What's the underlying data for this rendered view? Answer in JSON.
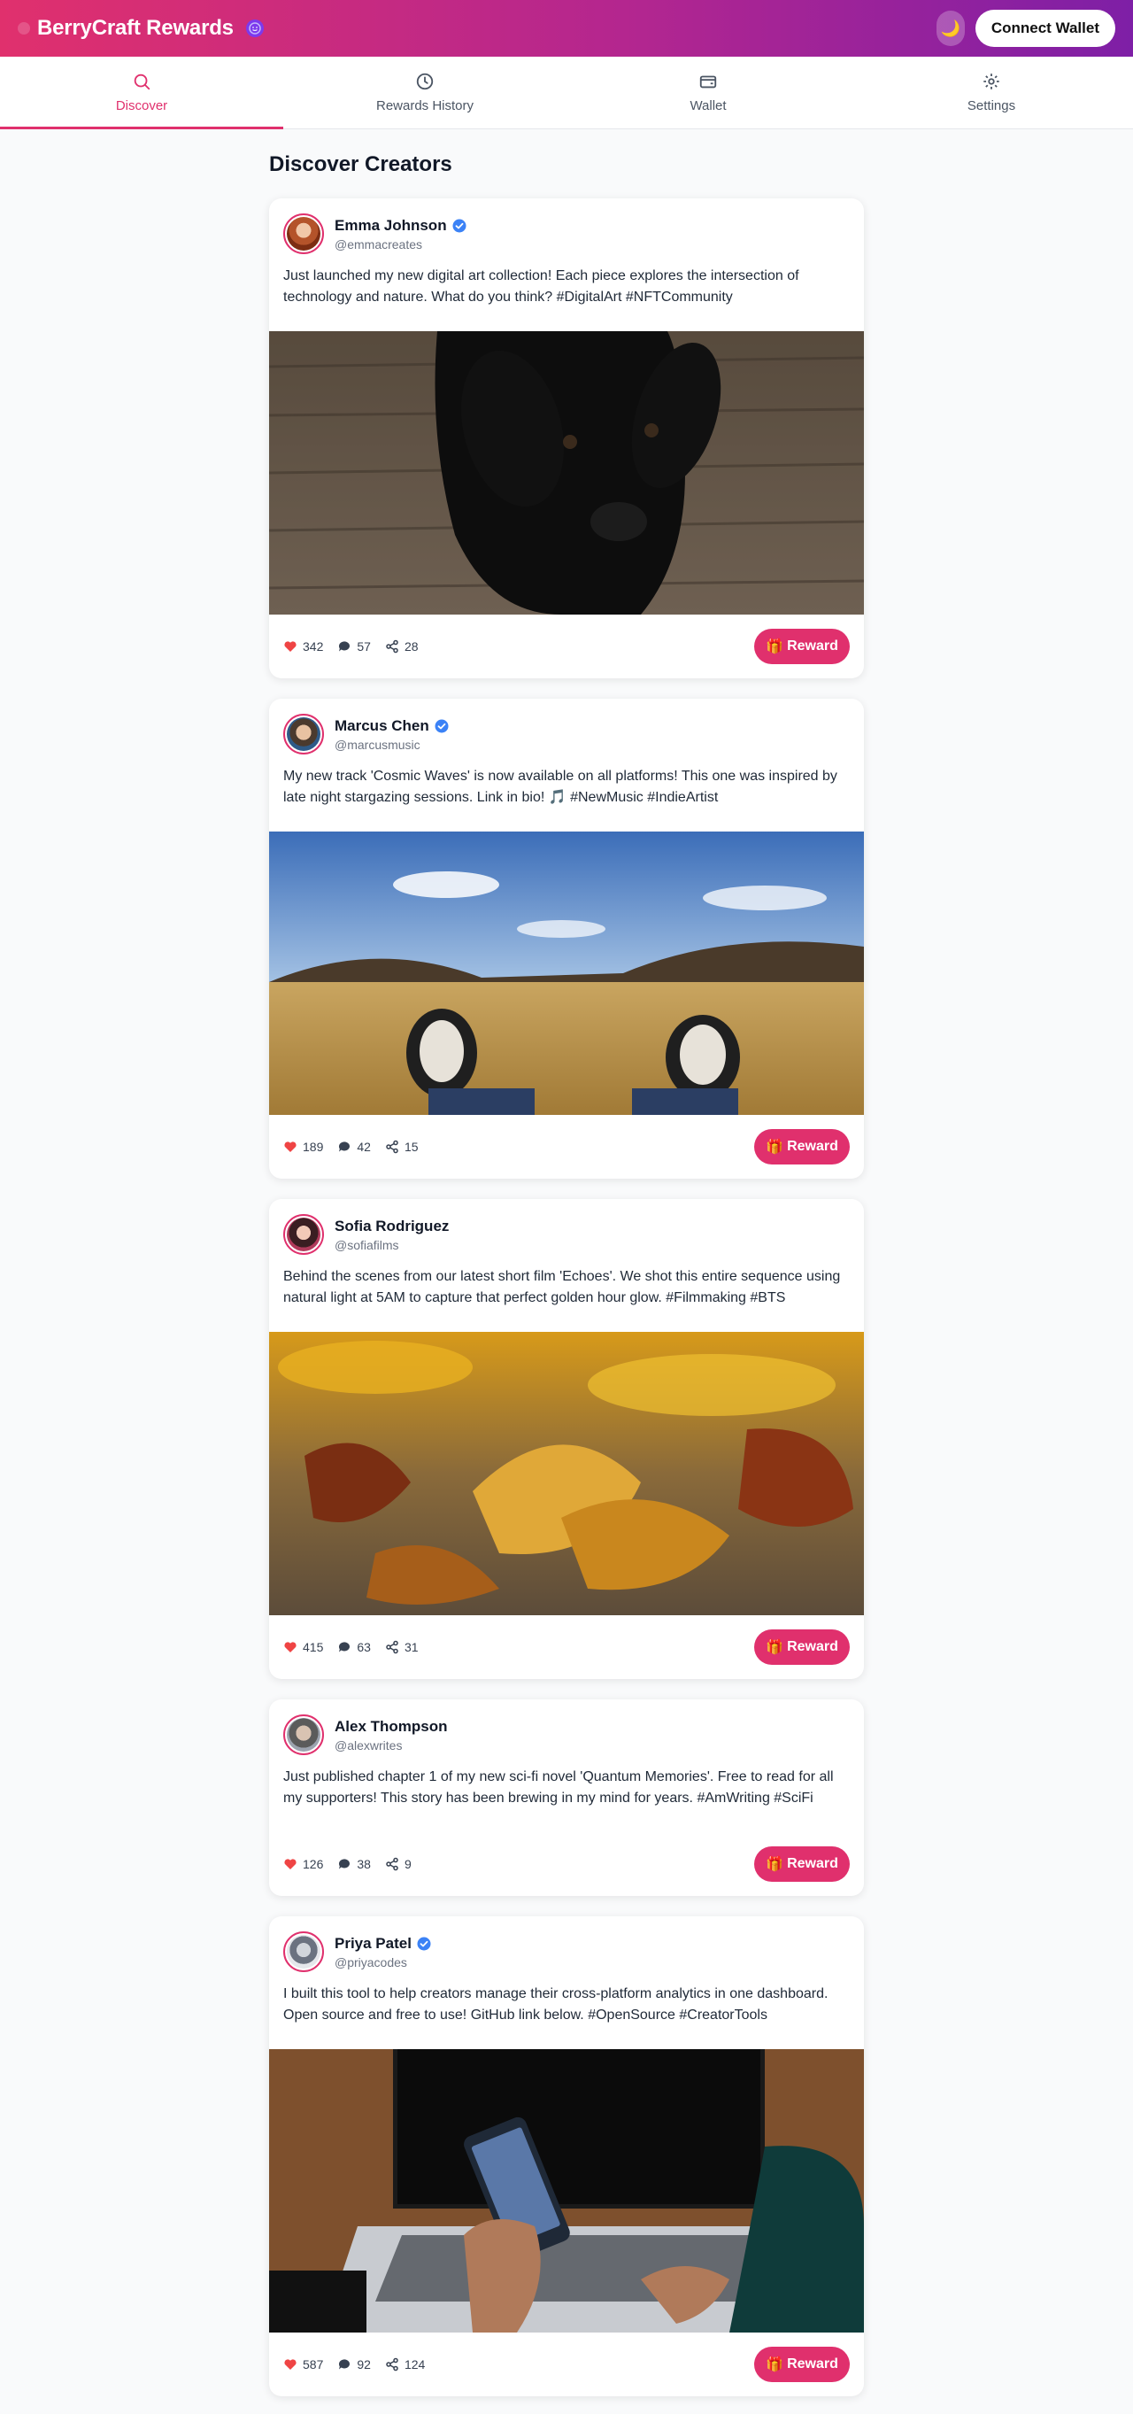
{
  "header": {
    "title": "BerryCraft Rewards",
    "wallet_label": "Connect Wallet",
    "theme_icon": "moon-icon"
  },
  "tabs": [
    {
      "label": "Discover",
      "icon": "search-icon",
      "active": true
    },
    {
      "label": "Rewards History",
      "icon": "clock-icon",
      "active": false
    },
    {
      "label": "Wallet",
      "icon": "wallet-icon",
      "active": false
    },
    {
      "label": "Settings",
      "icon": "gear-icon",
      "active": false
    }
  ],
  "page_title": "Discover Creators",
  "colors": {
    "accent": "#e0306d",
    "verified": "#3b82f6",
    "like": "#ef4444"
  },
  "reward_label": "Reward",
  "posts": [
    {
      "name": "Emma Johnson",
      "handle": "@emmacreates",
      "verified": true,
      "text": "Just launched my new digital art collection! Each piece explores the intersection of technology and nature. What do you think? #DigitalArt #NFTCommunity",
      "media": "black puppy on wooden floor",
      "likes": "342",
      "comments": "57",
      "shares": "28"
    },
    {
      "name": "Marcus Chen",
      "handle": "@marcusmusic",
      "verified": true,
      "text": "My new track 'Cosmic Waves' is now available on all platforms! This one was inspired by late night stargazing sessions. Link in bio! 🎵 #NewMusic #IndieArtist",
      "media": "sneakers on a grassy field under blue sky",
      "likes": "189",
      "comments": "42",
      "shares": "15"
    },
    {
      "name": "Sofia Rodriguez",
      "handle": "@sofiafilms",
      "verified": false,
      "text": "Behind the scenes from our latest short film 'Echoes'. We shot this entire sequence using natural light at 5AM to capture that perfect golden hour glow. #Filmmaking #BTS",
      "media": "autumn leaves on the ground",
      "likes": "415",
      "comments": "63",
      "shares": "31"
    },
    {
      "name": "Alex Thompson",
      "handle": "@alexwrites",
      "verified": false,
      "text": "Just published chapter 1 of my new sci-fi novel 'Quantum Memories'. Free to read for all my supporters! This story has been brewing in my mind for years. #AmWriting #SciFi",
      "media": "",
      "likes": "126",
      "comments": "38",
      "shares": "9"
    },
    {
      "name": "Priya Patel",
      "handle": "@priyacodes",
      "verified": true,
      "text": "I built this tool to help creators manage their cross-platform analytics in one dashboard. Open source and free to use! GitHub link below. #OpenSource #CreatorTools",
      "media": "person holding phone in front of laptop",
      "likes": "587",
      "comments": "92",
      "shares": "124"
    }
  ]
}
